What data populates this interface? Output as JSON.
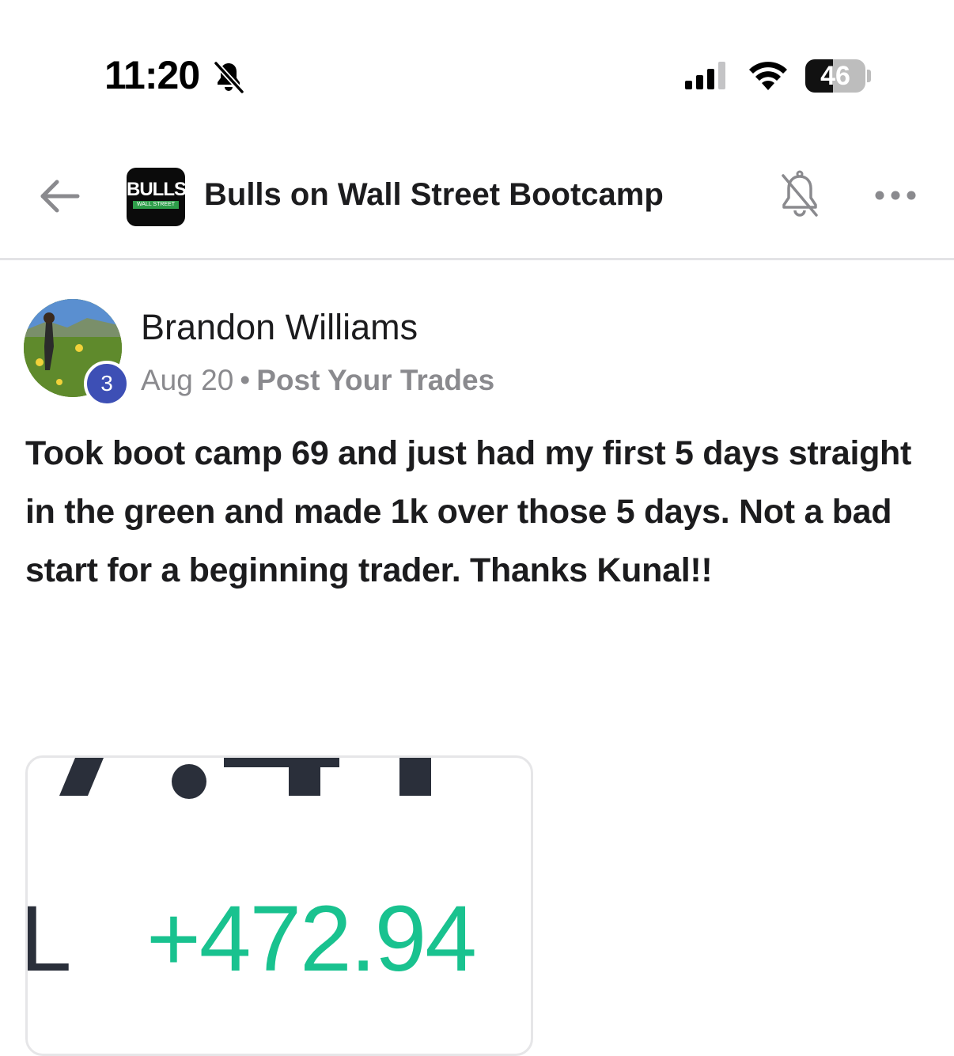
{
  "status_bar": {
    "time": "11:20",
    "battery": "46",
    "battery_level": 0.46
  },
  "nav": {
    "group_logo_text": "BULLS",
    "group_logo_sub": "WALL STREET",
    "group_title": "Bulls on Wall Street Bootcamp"
  },
  "post": {
    "author": "Brandon Williams",
    "badge_level": "3",
    "date": "Aug 20",
    "separator": "•",
    "category": "Post Your Trades",
    "body": "Took boot camp 69 and just had my first 5 days straight in the green and made 1k over those 5 days. Not a bad start for a beginning trader. Thanks Kunal!!",
    "image": {
      "pnl_label": "L",
      "pnl_value": "+472.94",
      "value_color": "#19c28f"
    }
  }
}
